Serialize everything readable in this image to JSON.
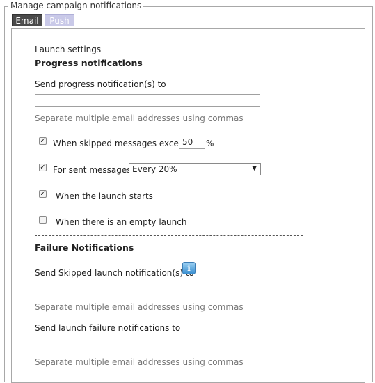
{
  "legend": "Manage campaign notifications",
  "tabs": {
    "email": "Email",
    "push": "Push"
  },
  "launch_settings": "Launch settings",
  "progress": {
    "heading": "Progress notifications",
    "send_label": "Send progress notification(s) to",
    "email_value": "",
    "hint": "Separate multiple email addresses using commas",
    "skipped_label": "When skipped messages exceed",
    "skipped_checked": true,
    "skipped_value": "50",
    "percent": "%",
    "sent_label": "For sent messages",
    "sent_checked": true,
    "sent_select": "Every 20%",
    "starts_label": "When the launch starts",
    "starts_checked": true,
    "empty_label": "When there is an empty launch",
    "empty_checked": false
  },
  "failure": {
    "heading": "Failure Notifications",
    "skipped_label": "Send Skipped launch notification(s) to",
    "skipped_hint": "Separate multiple email addresses using commas",
    "failure_label": "Send launch failure notifications to",
    "failure_hint": "Separate multiple email addresses using commas"
  },
  "icons": {
    "info": "info-icon",
    "check": "✓",
    "dropdown": "▼",
    "info_glyph": "i"
  }
}
